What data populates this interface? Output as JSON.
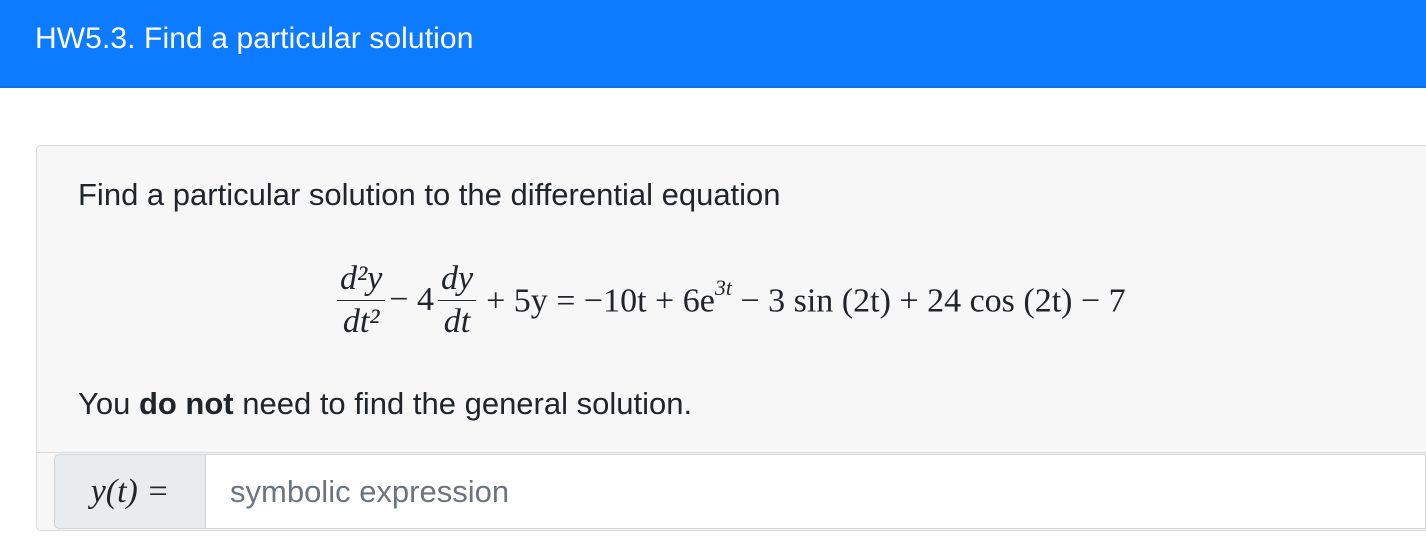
{
  "header": {
    "title": "HW5.3. Find a particular solution",
    "color": "#0d7bff"
  },
  "question": {
    "prompt": "Find a particular solution to the differential equation",
    "equation": {
      "term1_num": "d²y",
      "term1_den": "dt²",
      "minus4": "− 4",
      "term2_num": "dy",
      "term2_den": "dt",
      "rhs_prefix": "+ 5y = −10t + 6e",
      "exponent": "3t",
      "rhs_suffix": "− 3 sin (2t) + 24 cos (2t) − 7"
    },
    "note_pre": "You ",
    "note_bold": "do not",
    "note_post": " need to find the general solution."
  },
  "answer": {
    "label": "y(t) =",
    "placeholder": "symbolic expression",
    "value": ""
  }
}
